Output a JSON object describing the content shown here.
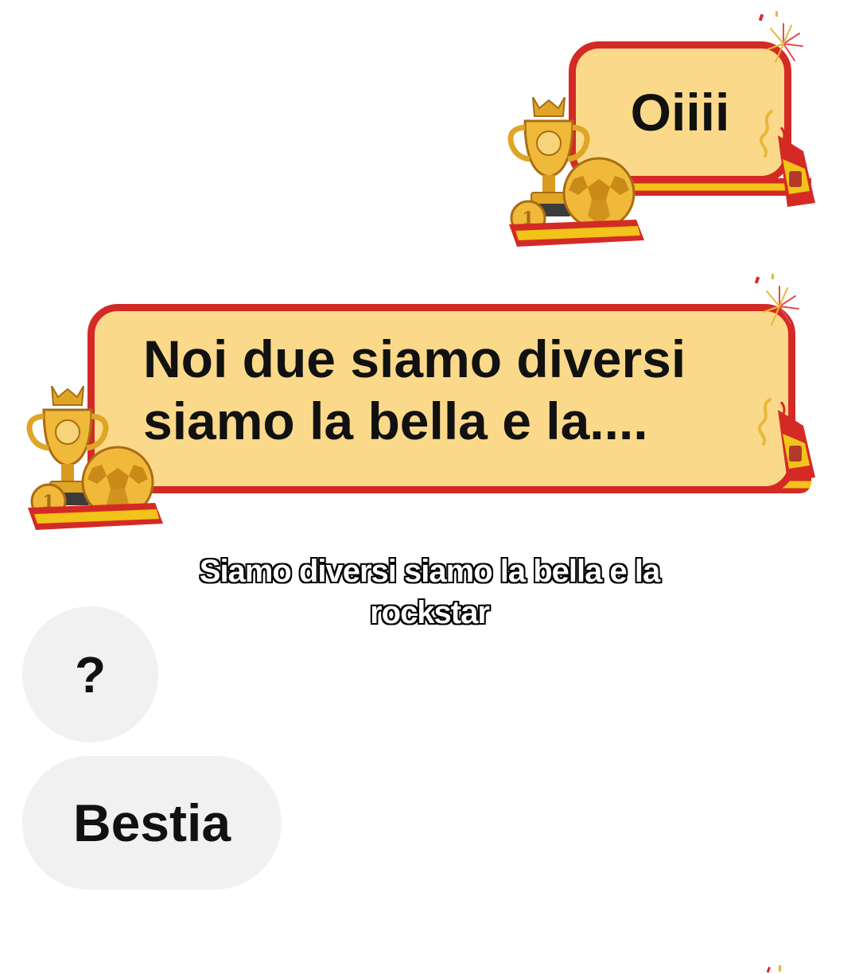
{
  "messages": {
    "sent": [
      {
        "text": "Oiiii"
      },
      {
        "text_line1": "Noi due siamo diversi",
        "text_line2": "siamo la bella e la...."
      }
    ],
    "received": [
      {
        "text": "?"
      },
      {
        "text": "Bestia"
      }
    ]
  },
  "caption": {
    "line1": "Siamo diversi siamo la bella e la",
    "line2": "rockstar"
  },
  "theme": {
    "bubble_fill": "#fbd98a",
    "bubble_border": "#d42a26",
    "flag_yellow": "#f2c318",
    "incoming_bubble": "#f1f1f1",
    "icons": [
      "trophy-icon",
      "football-icon",
      "medal-icon",
      "fireworks-icon",
      "scarf-icon"
    ]
  }
}
